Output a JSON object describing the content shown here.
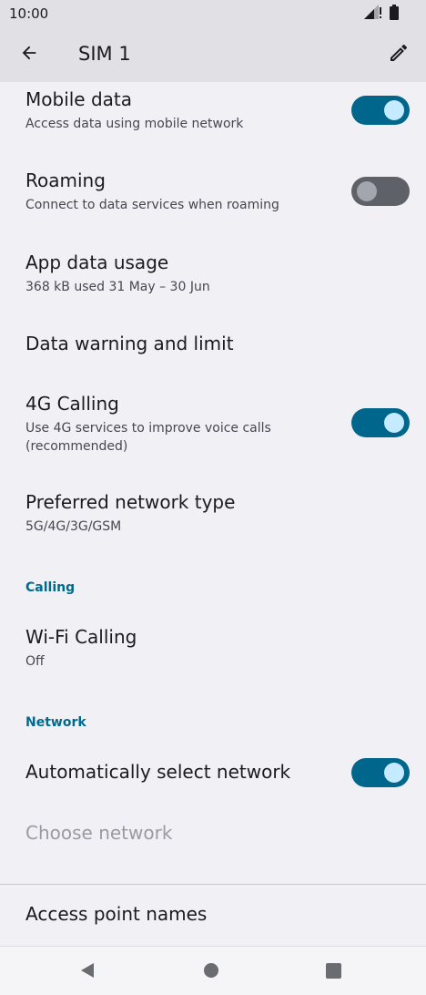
{
  "status_bar": {
    "time": "10:00"
  },
  "app_bar": {
    "title": "SIM 1"
  },
  "items": {
    "mobile_data": {
      "title": "Mobile data",
      "subtitle": "Access data using mobile network",
      "enabled": true
    },
    "roaming": {
      "title": "Roaming",
      "subtitle": "Connect to data services when roaming",
      "enabled": false
    },
    "app_data_usage": {
      "title": "App data usage",
      "subtitle": "368 kB used 31 May – 30 Jun"
    },
    "data_warning": {
      "title": "Data warning and limit"
    },
    "calling_4g": {
      "title": "4G Calling",
      "subtitle": "Use 4G services to improve voice calls (recommended)",
      "enabled": true
    },
    "preferred_network": {
      "title": "Preferred network type",
      "subtitle": "5G/4G/3G/GSM"
    },
    "wifi_calling": {
      "title": "Wi-Fi Calling",
      "subtitle": "Off"
    },
    "auto_network": {
      "title": "Automatically select network",
      "enabled": true
    },
    "choose_network": {
      "title": "Choose network"
    },
    "apn": {
      "title": "Access point names"
    }
  },
  "sections": {
    "calling": "Calling",
    "network": "Network"
  },
  "colors": {
    "accent": "#00668b",
    "section_header": "#006a8e",
    "background": "#f1f1f5",
    "app_bar": "#e1e1e5"
  },
  "icons": {
    "back": "arrow-left-icon",
    "edit": "pencil-icon",
    "signal": "signal-icon",
    "battery": "battery-icon",
    "nav_back": "triangle-back-icon",
    "nav_home": "circle-home-icon",
    "nav_recents": "square-recents-icon"
  }
}
